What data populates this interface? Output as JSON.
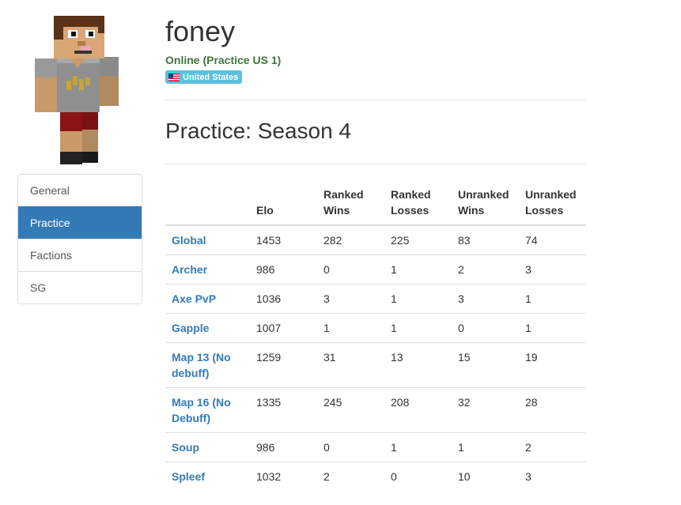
{
  "player": {
    "name": "foney",
    "status": "Online (Practice US 1)",
    "country": "United States"
  },
  "nav": {
    "items": [
      {
        "label": "General"
      },
      {
        "label": "Practice",
        "active": true
      },
      {
        "label": "Factions"
      },
      {
        "label": "SG"
      }
    ]
  },
  "season": {
    "title": "Practice: Season 4"
  },
  "table": {
    "headers": [
      "",
      "Elo",
      "Ranked\nWins",
      "Ranked\nLosses",
      "Unranked\nWins",
      "Unranked\nLosses"
    ],
    "rows": [
      [
        "Global",
        "1453",
        "282",
        "225",
        "83",
        "74"
      ],
      [
        "Archer",
        "986",
        "0",
        "1",
        "2",
        "3"
      ],
      [
        "Axe PvP",
        "1036",
        "3",
        "1",
        "3",
        "1"
      ],
      [
        "Gapple",
        "1007",
        "1",
        "1",
        "0",
        "1"
      ],
      [
        "Map 13 (No debuff)",
        "1259",
        "31",
        "13",
        "15",
        "19"
      ],
      [
        "Map 16 (No Debuff)",
        "1335",
        "245",
        "208",
        "32",
        "28"
      ],
      [
        "Soup",
        "986",
        "0",
        "1",
        "1",
        "2"
      ],
      [
        "Spleef",
        "1032",
        "2",
        "0",
        "10",
        "3"
      ]
    ]
  },
  "colors": {
    "accent": "#337ab7",
    "online": "#3c763d",
    "badge": "#5bc0de"
  }
}
